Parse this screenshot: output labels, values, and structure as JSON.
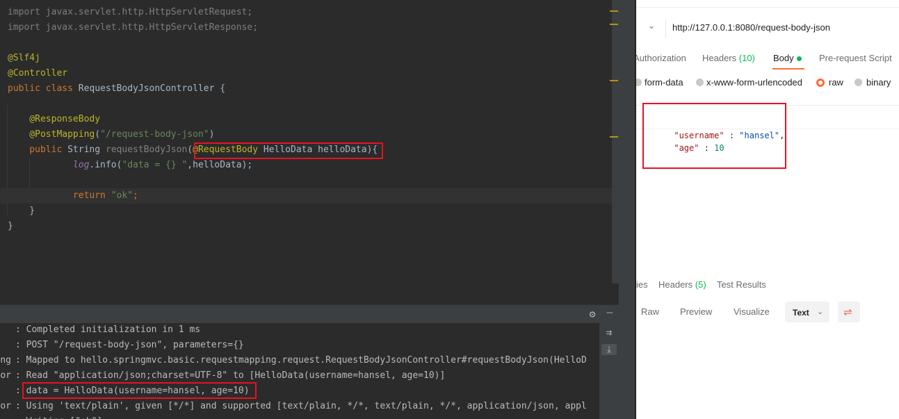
{
  "editor": {
    "lines": [
      {
        "tokens": [
          {
            "t": "import javax.servlet.http.HttpServletRequest;",
            "c": "t-import"
          }
        ]
      },
      {
        "tokens": [
          {
            "t": "import javax.servlet.http.HttpServletResponse;",
            "c": "t-import"
          }
        ]
      },
      {
        "tokens": []
      },
      {
        "tokens": [
          {
            "t": "@Slf4j",
            "c": "t-ann"
          }
        ]
      },
      {
        "tokens": [
          {
            "t": "@Controller",
            "c": "t-ann"
          }
        ]
      },
      {
        "tokens": [
          {
            "t": "public class ",
            "c": "t-kw"
          },
          {
            "t": "RequestBodyJsonController {",
            "c": "t-plain"
          }
        ]
      },
      {
        "tokens": []
      },
      {
        "tokens": [
          {
            "t": "    @ResponseBody",
            "c": "t-ann"
          }
        ]
      },
      {
        "tokens": [
          {
            "t": "    @PostMapping",
            "c": "t-ann"
          },
          {
            "t": "(",
            "c": "t-plain"
          },
          {
            "t": "\"/request-body-json\"",
            "c": "t-str"
          },
          {
            "t": ")",
            "c": "t-plain"
          }
        ]
      },
      {
        "tokens": [
          {
            "t": "    public ",
            "c": "t-kw"
          },
          {
            "t": "String ",
            "c": "t-plain"
          },
          {
            "t": "requestBodyJson",
            "c": "t-dim"
          },
          {
            "t": "(",
            "c": "t-plain"
          },
          {
            "t": "@RequestBody ",
            "c": "t-ann"
          },
          {
            "t": "HelloData helloData){",
            "c": "t-plain"
          }
        ]
      },
      {
        "tokens": [
          {
            "t": "            ",
            "c": "t-plain"
          },
          {
            "t": "log",
            "c": "t-log"
          },
          {
            "t": ".info(",
            "c": "t-plain"
          },
          {
            "t": "\"data = {} \"",
            "c": "t-str"
          },
          {
            "t": ",helloData);",
            "c": "t-plain"
          }
        ]
      },
      {
        "tokens": []
      },
      {
        "tokens": [
          {
            "t": "            return ",
            "c": "t-kw"
          },
          {
            "t": "\"ok\"",
            "c": "t-str"
          },
          {
            "t": ";",
            "c": "t-kw"
          }
        ]
      },
      {
        "tokens": [
          {
            "t": "    }",
            "c": "t-plain"
          }
        ]
      },
      {
        "tokens": [
          {
            "t": "}",
            "c": "t-plain"
          }
        ]
      }
    ]
  },
  "console": {
    "lines": [
      {
        "prefix": "",
        "text": ": Completed initialization in 1 ms"
      },
      {
        "prefix": "",
        "text": ": POST \"/request-body-json\", parameters={}"
      },
      {
        "prefix": "ng",
        "text": ": Mapped to hello.springmvc.basic.requestmapping.request.RequestBodyJsonController#requestBodyJson(HelloD"
      },
      {
        "prefix": "or",
        "text": ": Read \"application/json;charset=UTF-8\" to [HelloData(username=hansel, age=10)]"
      },
      {
        "prefix": "",
        "text": ": data = HelloData(username=hansel, age=10)"
      },
      {
        "prefix": "or",
        "text": ": Using 'text/plain', given [*/*] and supported [text/plain, */*, text/plain, */*, application/json, appl"
      },
      {
        "prefix": "",
        "text": ": Writing [\"ok\"]"
      }
    ],
    "settings_icon": "⚙",
    "minimize_icon": "—",
    "wrap_icon": "⇉",
    "scroll_icon": "⤓"
  },
  "postman": {
    "url": "http://127.0.0.1:8080/request-body-json",
    "url_chevron": "⌄",
    "tabs": {
      "authorization": "Authorization",
      "headers_label": "Headers",
      "headers_count": "(10)",
      "body": "Body",
      "prerequest": "Pre-request Script"
    },
    "body_types": {
      "form_data": "form-data",
      "urlencoded": "x-www-form-urlencoded",
      "raw": "raw",
      "binary": "binary"
    },
    "json": {
      "line1_key": "\"username\"",
      "line1_sep": " : ",
      "line1_val": "\"hansel\"",
      "line1_end": ",",
      "line2_key": "\"age\"",
      "line2_sep": " : ",
      "line2_val": "10"
    },
    "response": {
      "tab_partial": "ies",
      "headers_label": "Headers",
      "headers_count": "(5)",
      "tests": "Test Results",
      "view_raw": "Raw",
      "view_preview": "Preview",
      "view_visualize": "Visualize",
      "format": "Text",
      "format_chevron": "⌄",
      "wrap_icon": "⇌"
    }
  },
  "colors": {
    "highlight": "#e81123",
    "accent": "#ff6c37",
    "success": "#0cbb52"
  }
}
